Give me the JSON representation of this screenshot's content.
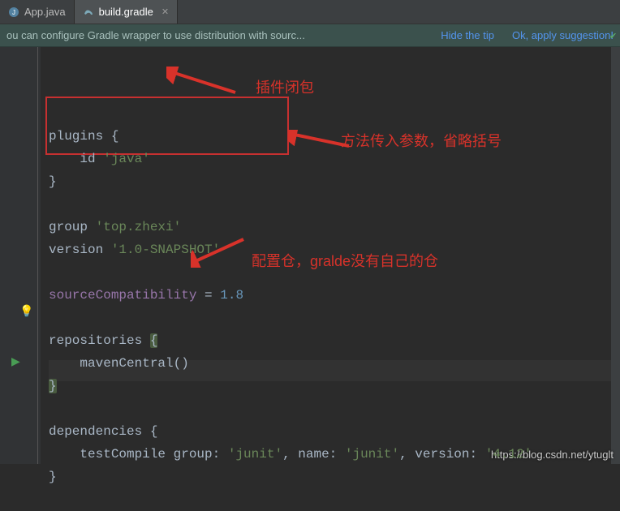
{
  "tabs": {
    "app": {
      "label": "App.java",
      "icon": "java"
    },
    "build": {
      "label": "build.gradle",
      "icon": "gradle"
    }
  },
  "banner": {
    "message": "ou can configure Gradle wrapper to use distribution with sourc...",
    "hide": "Hide the tip",
    "apply": "Ok, apply suggestion!"
  },
  "code": {
    "l1": "plugins {",
    "l2_id": "    id ",
    "l2_str": "'java'",
    "l3": "}",
    "l4a": "group ",
    "l4b": "'top.zhexi'",
    "l5a": "version ",
    "l5b": "'1.0-SNAPSHOT'",
    "l6a": "sourceCompatibility",
    "l6b": " = ",
    "l6c": "1.8",
    "l7": "repositories ",
    "l7br": "{",
    "l8": "    mavenCentral()",
    "l9": "}",
    "l10": "dependencies {",
    "l11a": "    testCompile ",
    "l11b": "group: ",
    "l11c": "'junit'",
    "l11d": ", name: ",
    "l11e": "'junit'",
    "l11f": ", version: ",
    "l11g": "'4.12'",
    "l12": "}"
  },
  "notes": {
    "n1": "插件闭包",
    "n2": "方法传入参数，省略括号",
    "n3": "配置仓，gralde没有自己的仓"
  },
  "watermark": "https://blog.csdn.net/ytuglt"
}
